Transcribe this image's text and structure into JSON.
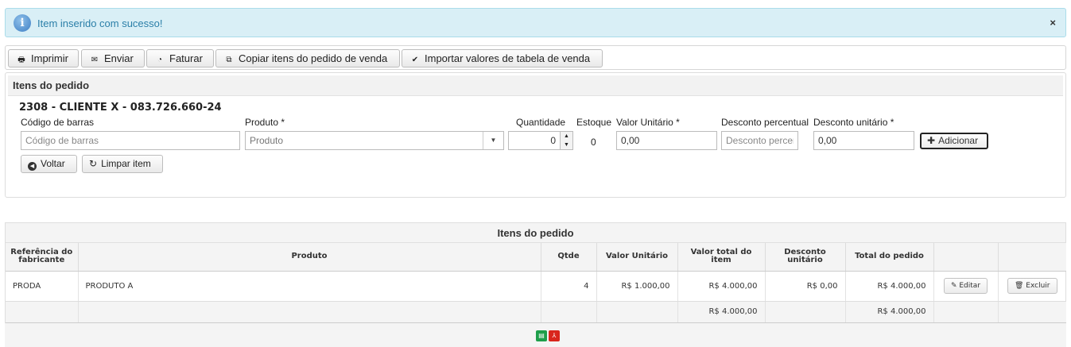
{
  "alert": {
    "message": "Item inserido com sucesso!",
    "close": "×",
    "icon": "info-icon"
  },
  "toolbar": {
    "print": "Imprimir",
    "send": "Enviar",
    "invoice": "Faturar",
    "copy": "Copiar itens do pedido de venda",
    "import": "Importar valores de tabela de venda"
  },
  "form": {
    "title": "Itens do pedido",
    "client": "2308 - CLIENTE X - 083.726.660-24",
    "barcode_label": "Código de barras",
    "barcode_placeholder": "Código de barras",
    "product_label": "Produto *",
    "product_value": "Produto",
    "qty_label": "Quantidade",
    "qty_value": "0",
    "stock_label": "Estoque",
    "stock_value": "0",
    "unit_value_label": "Valor Unitário *",
    "unit_value": "0,00",
    "pct_discount_label": "Desconto percentual",
    "pct_discount_placeholder": "Desconto percentual",
    "unit_discount_label": "Desconto unitário *",
    "unit_discount": "0,00",
    "add": "Adicionar",
    "back": "Voltar",
    "clear": "Limpar item"
  },
  "table": {
    "title": "Itens do pedido",
    "headers": [
      "Referência do fabricante",
      "Produto",
      "Qtde",
      "Valor Unitário",
      "Valor total do item",
      "Desconto unitário",
      "Total do pedido",
      "",
      ""
    ],
    "rows": [
      {
        "ref": "PRODA",
        "product": "PRODUTO A",
        "qty": "4",
        "unit": "R$ 1.000,00",
        "total_item": "R$ 4.000,00",
        "discount": "R$ 0,00",
        "total": "R$ 4.000,00",
        "edit": "Editar",
        "delete": "Excluir"
      }
    ],
    "totals": {
      "total_item": "R$ 4.000,00",
      "total": "R$ 4.000,00"
    }
  },
  "export": {
    "excel_icon": "excel-icon",
    "pdf_icon": "pdf-icon"
  },
  "colors": {
    "alert_bg": "#d9eff6",
    "alert_text": "#2b7fa8",
    "excel": "#1e9e4a",
    "pdf": "#d9261c"
  }
}
